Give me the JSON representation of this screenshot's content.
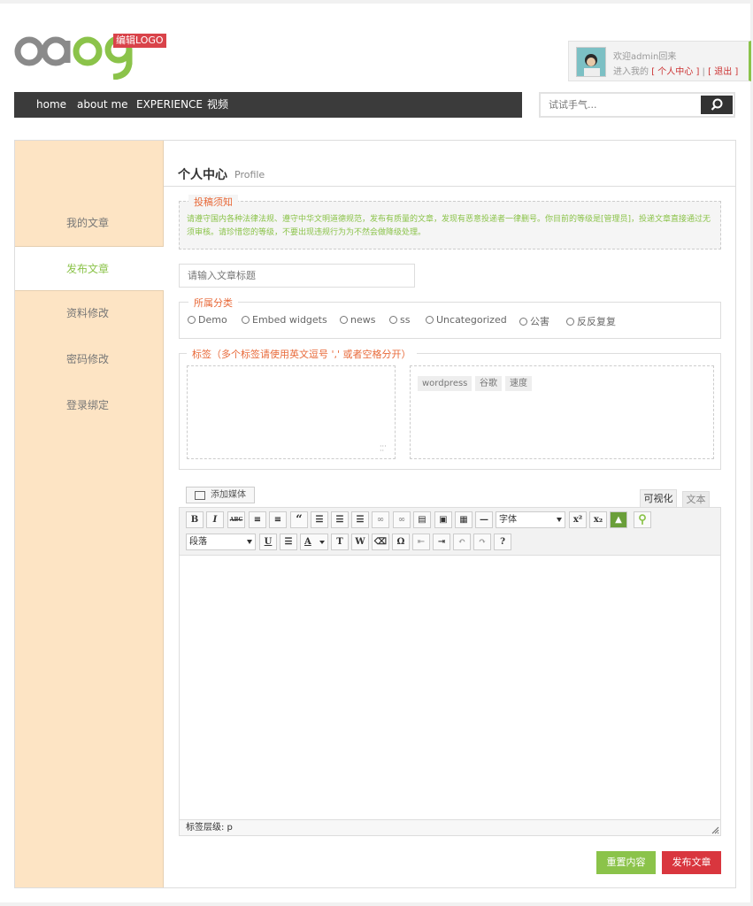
{
  "header": {
    "logo_badge": "编辑LOGO",
    "user": {
      "welcome": "欢迎admin回来",
      "prefix": "进入我的",
      "profile_link": "[ 个人中心 ]",
      "separator": "|",
      "logout_link": "[ 退出 ]"
    },
    "nav": [
      "home",
      "about me",
      "EXPERIENCE",
      "视频"
    ],
    "search_placeholder": "试试手气..."
  },
  "sidebar": {
    "items": [
      {
        "label": "我的文章",
        "active": false
      },
      {
        "label": "发布文章",
        "active": true
      },
      {
        "label": "资料修改",
        "active": false
      },
      {
        "label": "密码修改",
        "active": false
      },
      {
        "label": "登录绑定",
        "active": false
      }
    ]
  },
  "main": {
    "title": "个人中心",
    "subtitle": "Profile",
    "notice": {
      "legend": "投稿须知",
      "text": "请遵守国内各种法律法规、遵守中华文明道德规范，发布有质量的文章，发现有恶意投递者一律删号。你目前的等级是[管理员]，投递文章直接通过无须审核。请珍惜您的等级，不要出现违规行为为不然会做降级处理。"
    },
    "title_placeholder": "请输入文章标题",
    "category": {
      "legend": "所属分类",
      "options": [
        "Demo",
        "Embed widgets",
        "news",
        "ss",
        "Uncategorized",
        "公害",
        "反反复复"
      ]
    },
    "tags": {
      "legend": "标签（多个标签请使用英文逗号 ',' 或者空格分开）",
      "chips": [
        "wordpress",
        "谷歌",
        "速度"
      ]
    },
    "editor": {
      "add_media": "添加媒体",
      "tab_visual": "可视化",
      "tab_text": "文本",
      "font_select": "字体",
      "format_select": "段落",
      "status": "标签层级: p"
    },
    "buttons": {
      "reset": "重置内容",
      "publish": "发布文章"
    }
  },
  "colors": {
    "accent_green": "#8bc34a",
    "accent_red": "#d9363e",
    "nav_bg": "#3b3b3b",
    "sidebar_bg": "#fde4c4"
  }
}
